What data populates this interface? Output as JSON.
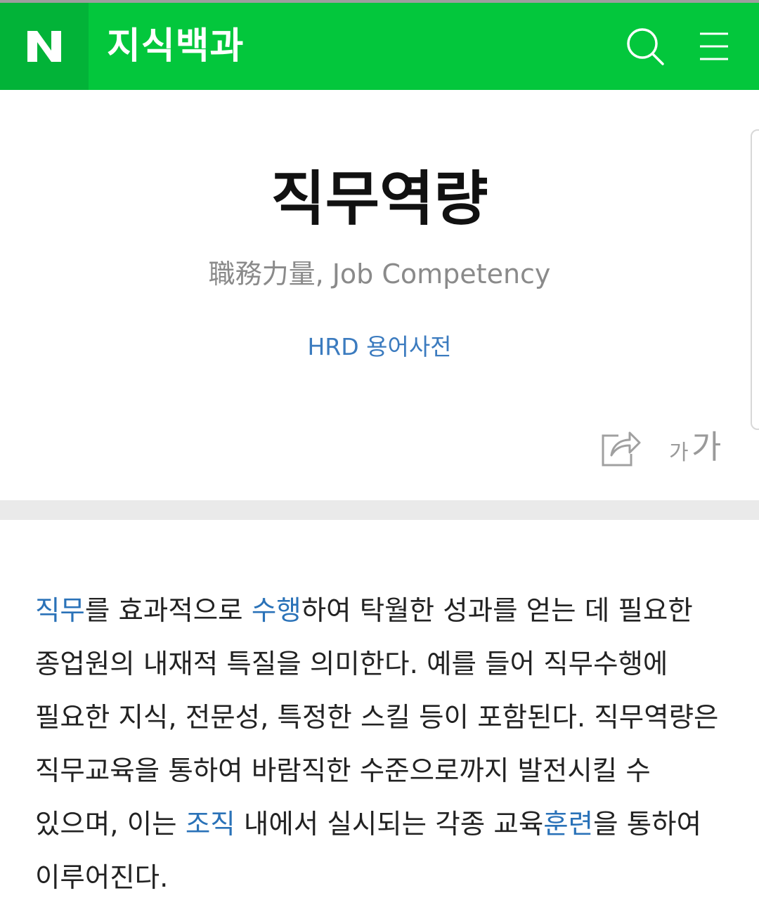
{
  "header": {
    "logo_letter": "N",
    "service_title": "지식백과",
    "search_icon": "search-icon",
    "menu_icon": "menu-icon"
  },
  "entry": {
    "title": "직무역량",
    "subtitle": "職務力量, Job Competency",
    "source": "HRD 용어사전",
    "share_icon": "share-icon",
    "font_size_small": "가",
    "font_size_big": "가"
  },
  "body": {
    "segments": [
      {
        "link": "직무"
      },
      {
        "text": "를 효과적으로 "
      },
      {
        "link": "수행"
      },
      {
        "text": "하여 탁월한 성과를 얻는 데 필요한 종업원의 내재적 특질을 의미한다. 예를 들어 직무수행에 필요한 지식, 전문성, 특정한 스킬 등이 포함된다. 직무역량은 직무교육을 통하여 바람직한 수준으로까지 발전시킬 수 있으며, 이는 "
      },
      {
        "link": "조직"
      },
      {
        "text": " 내에서 실시되는 각종 교육"
      },
      {
        "link": "훈련"
      },
      {
        "text": "을 통하여 이루어진다."
      }
    ]
  },
  "colors": {
    "header_green": "#03c73c",
    "logo_green": "#02b338",
    "link_blue": "#2a72b8"
  }
}
